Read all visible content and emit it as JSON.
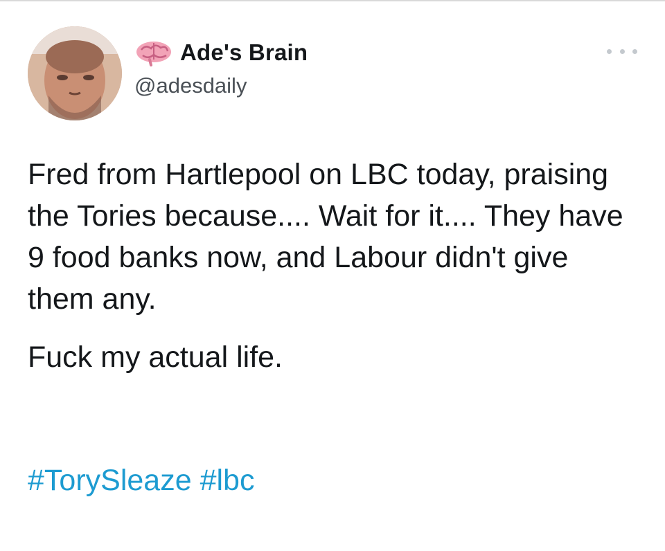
{
  "tweet": {
    "author": {
      "display_name": "Ade's Brain",
      "handle": "@adesdaily",
      "avatar_icon": "person-avatar",
      "name_emoji": "brain-icon"
    },
    "more_icon": "more-options-icon",
    "body": {
      "paragraph_1": "Fred from Hartlepool on LBC today, praising the Tories because.... Wait for it.... They have 9 food banks now, and Labour didn't give them any.",
      "paragraph_2": "Fuck my actual life."
    },
    "hashtags": [
      "#TorySleaze",
      "#lbc"
    ]
  },
  "colors": {
    "text": "#14171a",
    "secondary": "#4a5056",
    "link": "#1d9bd1",
    "background": "#ffffff"
  }
}
